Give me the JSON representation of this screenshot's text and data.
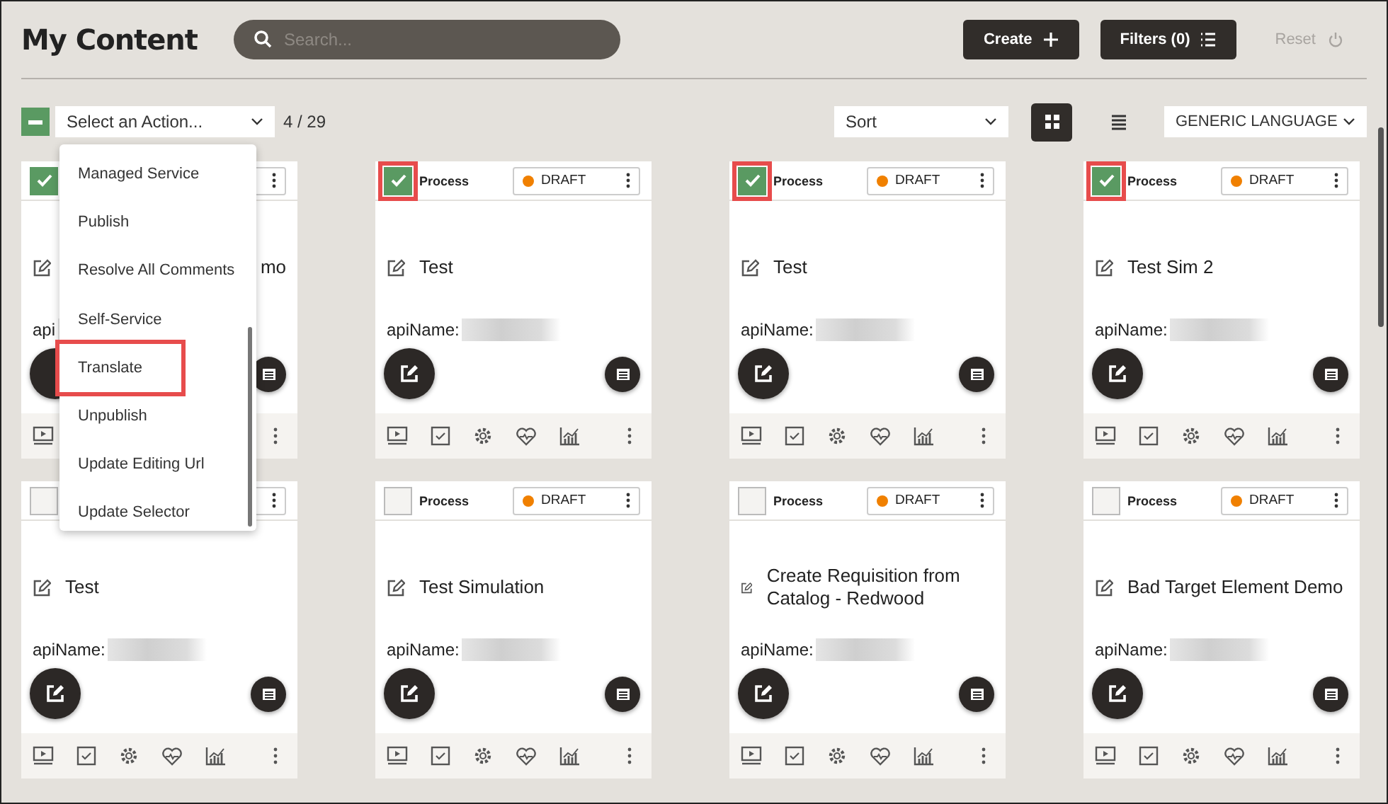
{
  "header": {
    "title": "My Content",
    "search": {
      "placeholder": "Search..."
    },
    "buttons": [
      {
        "label": "Create",
        "kind": "create"
      },
      {
        "label": "Filters (0)",
        "kind": "filters"
      }
    ],
    "reset": {
      "label": "Reset",
      "disabled": true
    }
  },
  "toolbar": {
    "select_all": {
      "indeterminate": true
    },
    "action_select": {
      "value": "Select an Action..."
    },
    "count": "4 / 29",
    "sort": {
      "value": "Sort"
    },
    "views": [
      {
        "kind": "grid",
        "selected": true
      },
      {
        "kind": "list",
        "selected": false
      }
    ],
    "language": {
      "value": "GENERIC LANGUAGE"
    }
  },
  "action_menu": {
    "items": [
      {
        "label": "Managed Service",
        "highlighted": false
      },
      {
        "label": "Publish",
        "highlighted": false
      },
      {
        "label": "Resolve All Comments",
        "highlighted": false
      },
      {
        "label": "Self-Service",
        "highlighted": false
      },
      {
        "label": "Translate",
        "highlighted": true
      },
      {
        "label": "Unpublish",
        "highlighted": false
      },
      {
        "label": "Update Editing Url",
        "highlighted": false
      },
      {
        "label": "Update Selector",
        "highlighted": false
      }
    ]
  },
  "cards": [
    {
      "checked": true,
      "highlighted": false,
      "covered": true,
      "title": "mo",
      "api_label": "api"
    },
    {
      "checked": true,
      "highlighted": true,
      "covered": false,
      "type": "Process",
      "status": "DRAFT",
      "title": "Test",
      "api_label": "apiName:"
    },
    {
      "checked": true,
      "highlighted": true,
      "covered": false,
      "type": "Process",
      "status": "DRAFT",
      "title": "Test",
      "api_label": "apiName:"
    },
    {
      "checked": true,
      "highlighted": true,
      "covered": false,
      "type": "Process",
      "status": "DRAFT",
      "title": "Test Sim 2",
      "api_label": "apiName:"
    },
    {
      "checked": false,
      "highlighted": false,
      "covered": false,
      "title": "Test",
      "api_label": "apiName:"
    },
    {
      "checked": false,
      "highlighted": false,
      "covered": false,
      "type": "Process",
      "status": "DRAFT",
      "title": "Test Simulation",
      "api_label": "apiName:"
    },
    {
      "checked": false,
      "highlighted": false,
      "covered": false,
      "type": "Process",
      "status": "DRAFT",
      "title": "Create Requisition from Catalog - Redwood",
      "api_label": "apiName:"
    },
    {
      "checked": false,
      "highlighted": false,
      "covered": false,
      "type": "Process",
      "status": "DRAFT",
      "title": "Bad Target Element Demo",
      "api_label": "apiName:"
    }
  ]
}
